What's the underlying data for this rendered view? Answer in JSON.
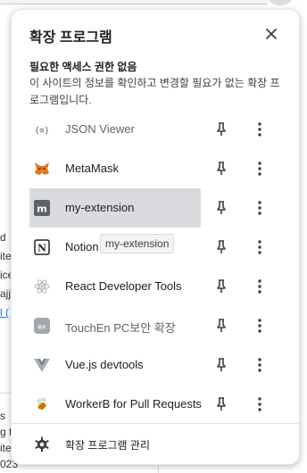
{
  "background": {
    "left_fragments": [
      "d",
      "ite",
      "ice",
      "ajj",
      "l ("
    ],
    "bottom_fragments": [
      "s",
      "g t",
      "ite",
      "023"
    ]
  },
  "popup": {
    "title": "확장 프로그램",
    "access_heading": "필요한 액세스 권한 없음",
    "access_description": "이 사이트의 정보를 확인하고 변경할 필요가 없는 확장 프로그램입니다.",
    "extensions": [
      {
        "name": "JSON Viewer",
        "icon": "json-viewer-icon",
        "dimmed": true,
        "active": false
      },
      {
        "name": "MetaMask",
        "icon": "metamask-fox-icon",
        "dimmed": false,
        "active": false
      },
      {
        "name": "my-extension",
        "icon": "letter-m-icon",
        "dimmed": false,
        "active": true
      },
      {
        "name": "Notion Web Clipper",
        "icon": "notion-icon",
        "dimmed": false,
        "active": false
      },
      {
        "name": "React Developer Tools",
        "icon": "react-icon",
        "dimmed": false,
        "active": false
      },
      {
        "name": "TouchEn PC보안 확장",
        "icon": "touchen-icon",
        "dimmed": true,
        "active": false
      },
      {
        "name": "Vue.js devtools",
        "icon": "vue-icon",
        "dimmed": false,
        "active": false
      },
      {
        "name": "WorkerB for Pull Requests",
        "icon": "workerb-bee-icon",
        "dimmed": false,
        "active": false
      }
    ],
    "tooltip": "my-extension",
    "manage_label": "확장 프로그램 관리"
  }
}
